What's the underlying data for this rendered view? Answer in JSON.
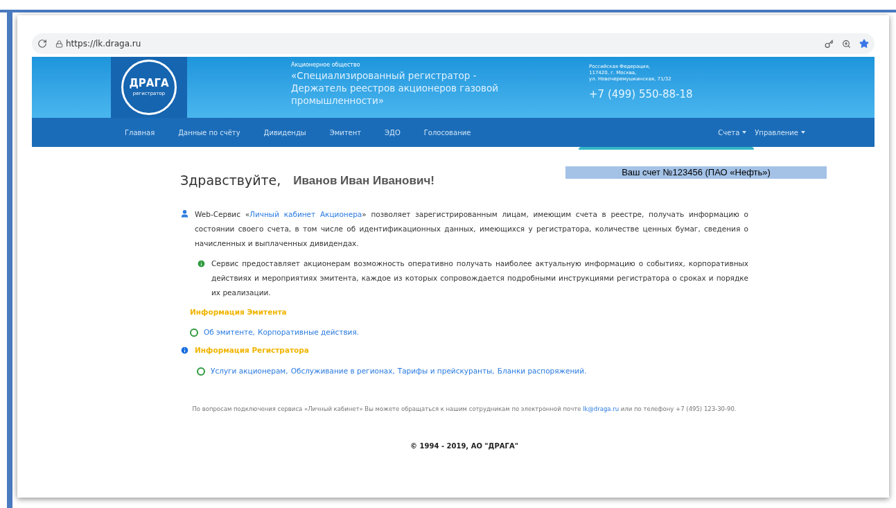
{
  "browser": {
    "url": "https://lk.draga.ru"
  },
  "header": {
    "logo_text": "ДРАГА",
    "logo_subtext": "регистратор",
    "org_type": "Акционерное общество",
    "org_name": "«Специализированный регистратор - Держатель реестров акционеров газовой промышленности»",
    "address": [
      "Российская Федерация,",
      "117420, г. Москва,",
      "ул. Новочеремушкинская, 71/32"
    ],
    "phone": "+7 (499) 550-88-18"
  },
  "nav": {
    "items": [
      {
        "label": "Главная"
      },
      {
        "label": "Данные по счёту"
      },
      {
        "label": "Дивиденды"
      },
      {
        "label": "Эмитент"
      },
      {
        "label": "ЭДО"
      },
      {
        "label": "Голосование"
      }
    ],
    "dropdowns": [
      {
        "label": "Счета"
      },
      {
        "label": "Управление"
      }
    ]
  },
  "greeting": {
    "hello": "Здравствуйте,",
    "name": "Иванов Иван Иванович!",
    "account": "Ваш счет №123456 (ПАО «Нефть»)"
  },
  "intro": {
    "before": "Web-Сервис «",
    "link": "Личный кабинет Акционера",
    "after": "» позволяет зарегистрированным лицам, имеющим счета в реестре, получать информацию о состоянии своего счета, в том числе об идентификационных данных, имеющихся у регистратора, количестве ценных бумаг, сведения о начисленных и выплаченных дивидендах."
  },
  "note": "Сервис предоставляет акционерам возможность оперативно получать наиболее актуальную информацию о событиях, корпоративных действиях и мероприятиях эмитента, каждое из которых сопровождается подробными инструкциями регистратора о сроках и порядке их реализации.",
  "sections": [
    {
      "title": "Информация Эмитента",
      "kind": "plain",
      "links": [
        "Об эмитенте,",
        "Корпоративные действия."
      ]
    },
    {
      "title": "Информация Регистратора",
      "kind": "info",
      "links": [
        "Услуги акционерам,",
        "Обслуживание в регионах,",
        "Тарифы и прейскуранты,",
        "Бланки распоряжений."
      ]
    }
  ],
  "contact": {
    "before": "По вопросам подключения сервиса «Личный кабинет» Вы можете обращаться к нашим сотрудникам по электронной почте ",
    "email": "lk@draga.ru",
    "after": " или по телефону +7 (495) 123-30-90."
  },
  "copyright": "© 1994 - 2019, АО \"ДРАГА\""
}
